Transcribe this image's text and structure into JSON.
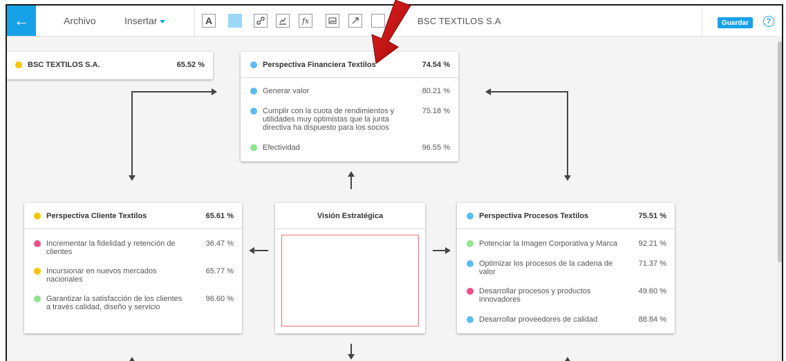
{
  "toolbar": {
    "back_label": "←",
    "menu_archivo": "Archivo",
    "menu_insertar": "Insertar",
    "tool_text": "A",
    "tool_fx": "fx",
    "doc_title": "BSC TEXTILOS S.A",
    "save_label": "Guardar",
    "help_label": "?"
  },
  "colors": {
    "accent": "#17a2e8",
    "yellow": "#f5c300",
    "blue": "#5bbcf0",
    "green": "#8fe58a",
    "pink": "#ef4f84",
    "fill_swatch": "#9bd9f7"
  },
  "root_card": {
    "title": "BSC TEXTILOS S.A.",
    "value": "65.52  %",
    "status": "yellow"
  },
  "financiera": {
    "title": "Perspectiva Financiera Textilos",
    "value": "74.54  %",
    "status": "blue",
    "items": [
      {
        "text": "Generar valor",
        "value": "80.21  %",
        "status": "blue"
      },
      {
        "text": "Cumplir con la cuota de rendimientos y utilidades muy optimistas que la junta directiva ha dispuesto para los socios",
        "value": "75.18  %",
        "status": "blue"
      },
      {
        "text": "Efectividad",
        "value": "96.55  %",
        "status": "green"
      }
    ]
  },
  "cliente": {
    "title": "Perspectiva Cliente Textilos",
    "value": "65.61  %",
    "status": "yellow",
    "items": [
      {
        "text": "Incrementar la fidelidad y retención de clientes",
        "value": "36.47  %",
        "status": "pink"
      },
      {
        "text": "Incursionar en nuevos mercados nacionales",
        "value": "65.77  %",
        "status": "yellow"
      },
      {
        "text": "Garantizar la satisfacción de los clientes a través calidad, diseño y servicio",
        "value": "96.60  %",
        "status": "green"
      }
    ]
  },
  "vision": {
    "title": "Visión Estratégica"
  },
  "procesos": {
    "title": "Perspectiva Procesos Textilos",
    "value": "75.51  %",
    "status": "blue",
    "items": [
      {
        "text": "Potenciar la Imagen Corporativa y Marca",
        "value": "92.21  %",
        "status": "green"
      },
      {
        "text": "Optimizar los procesos de la cadena de valor",
        "value": "71.37  %",
        "status": "blue"
      },
      {
        "text": "Desarrollar procesos y productos innovadores",
        "value": "49.60  %",
        "status": "pink"
      },
      {
        "text": "Desarrollar proveedores de calidad",
        "value": "88.84  %",
        "status": "blue"
      }
    ]
  }
}
